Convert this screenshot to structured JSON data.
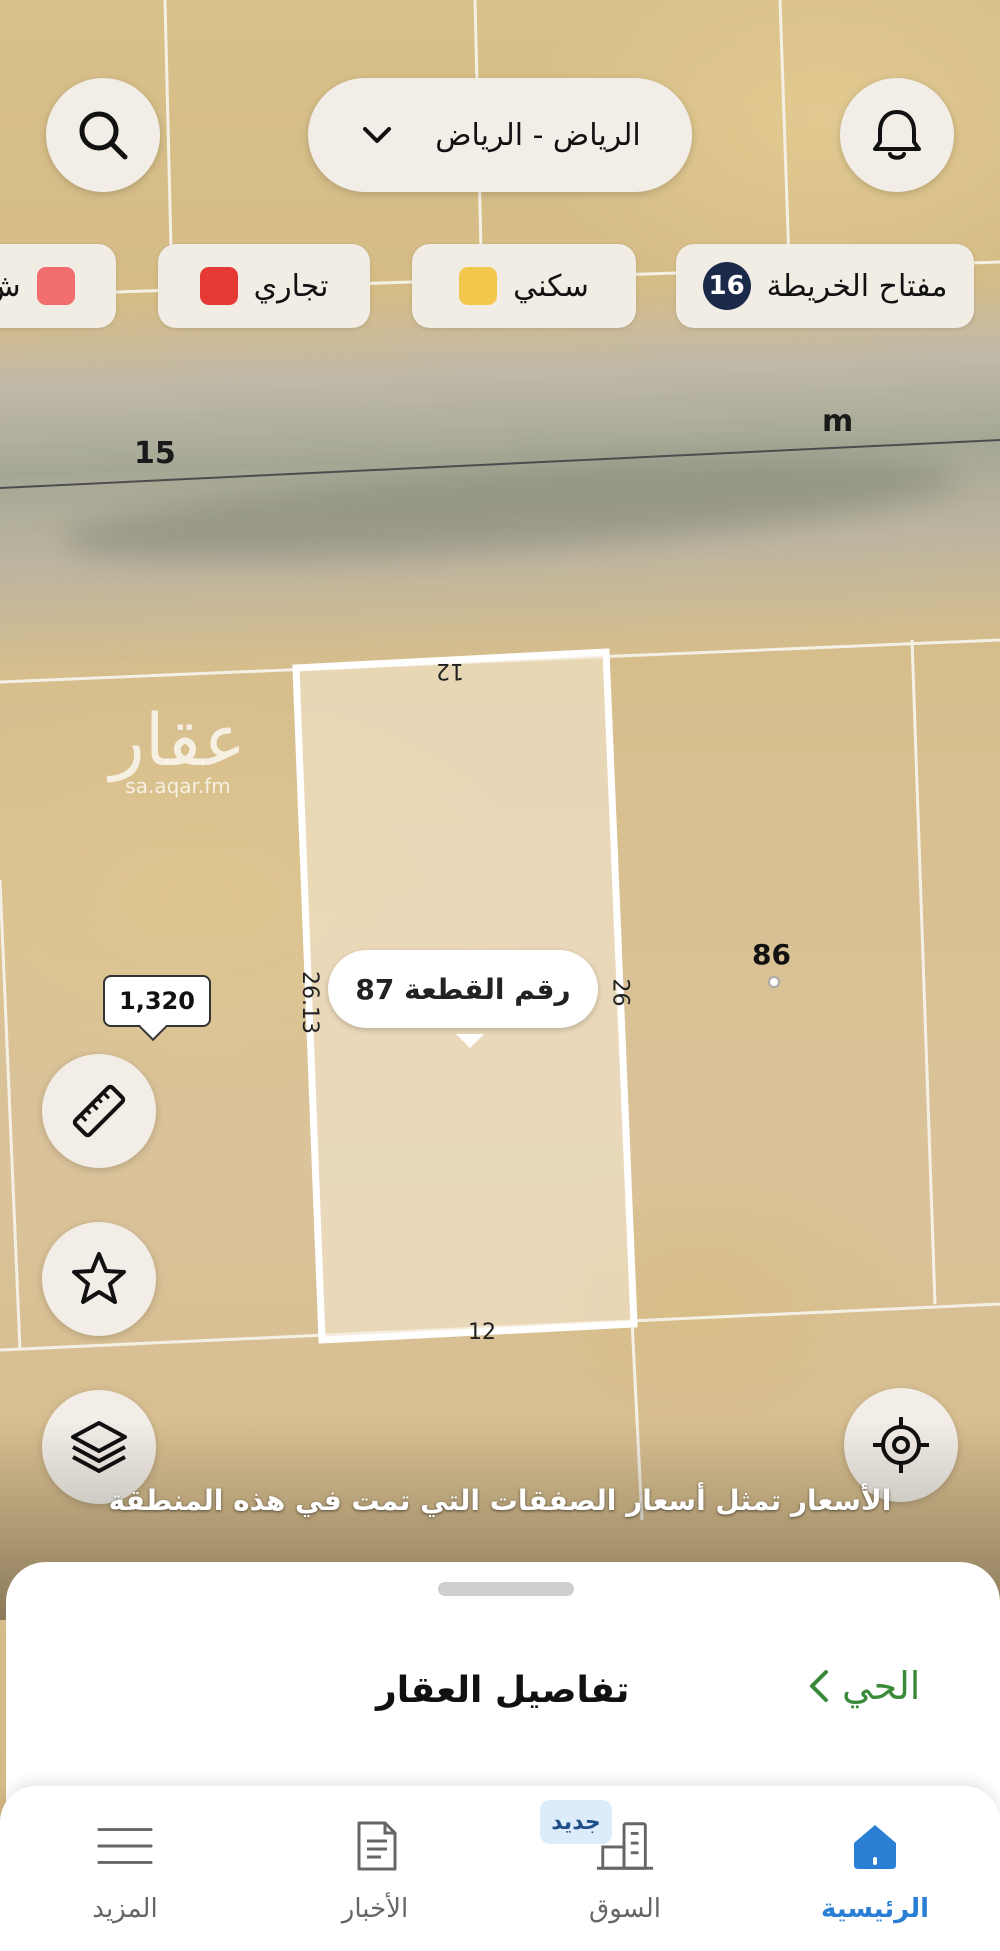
{
  "header": {
    "city_label": "الرياض - الرياض"
  },
  "legend": {
    "title": "مفتاح الخريطة",
    "count": "16",
    "chips": [
      {
        "label": "سكني",
        "color": "#f2c94c"
      },
      {
        "label": "تجاري",
        "color": "#e53935"
      },
      {
        "label": "ش",
        "color": "#f26d6d"
      }
    ]
  },
  "map": {
    "labels": {
      "plot_15": "15",
      "m_label": "m",
      "plot_86": "86",
      "top_edge": "12",
      "bottom_edge": "12",
      "left_edge": "26.13",
      "right_edge": "26"
    },
    "plot_callout": "رقم القطعة 87",
    "price_tag": "1,320",
    "watermark_main": "عقار",
    "watermark_url": "sa.aqar.fm"
  },
  "disclaimer": "الأسعار تمثل أسعار الصفقات التي تمت في هذه المنطقة",
  "sheet": {
    "title": "تفاصيل العقار",
    "district_link": "الحي"
  },
  "tabs": [
    {
      "label": "الرئيسية",
      "active": true
    },
    {
      "label": "السوق"
    },
    {
      "label": "الأخبار"
    },
    {
      "label": "المزيد"
    }
  ],
  "new_badge": "جديد",
  "colors": {
    "accent": "#2a7fd4",
    "link_green": "#3b8a3a",
    "legend_count_bg": "#1c2a4a"
  }
}
